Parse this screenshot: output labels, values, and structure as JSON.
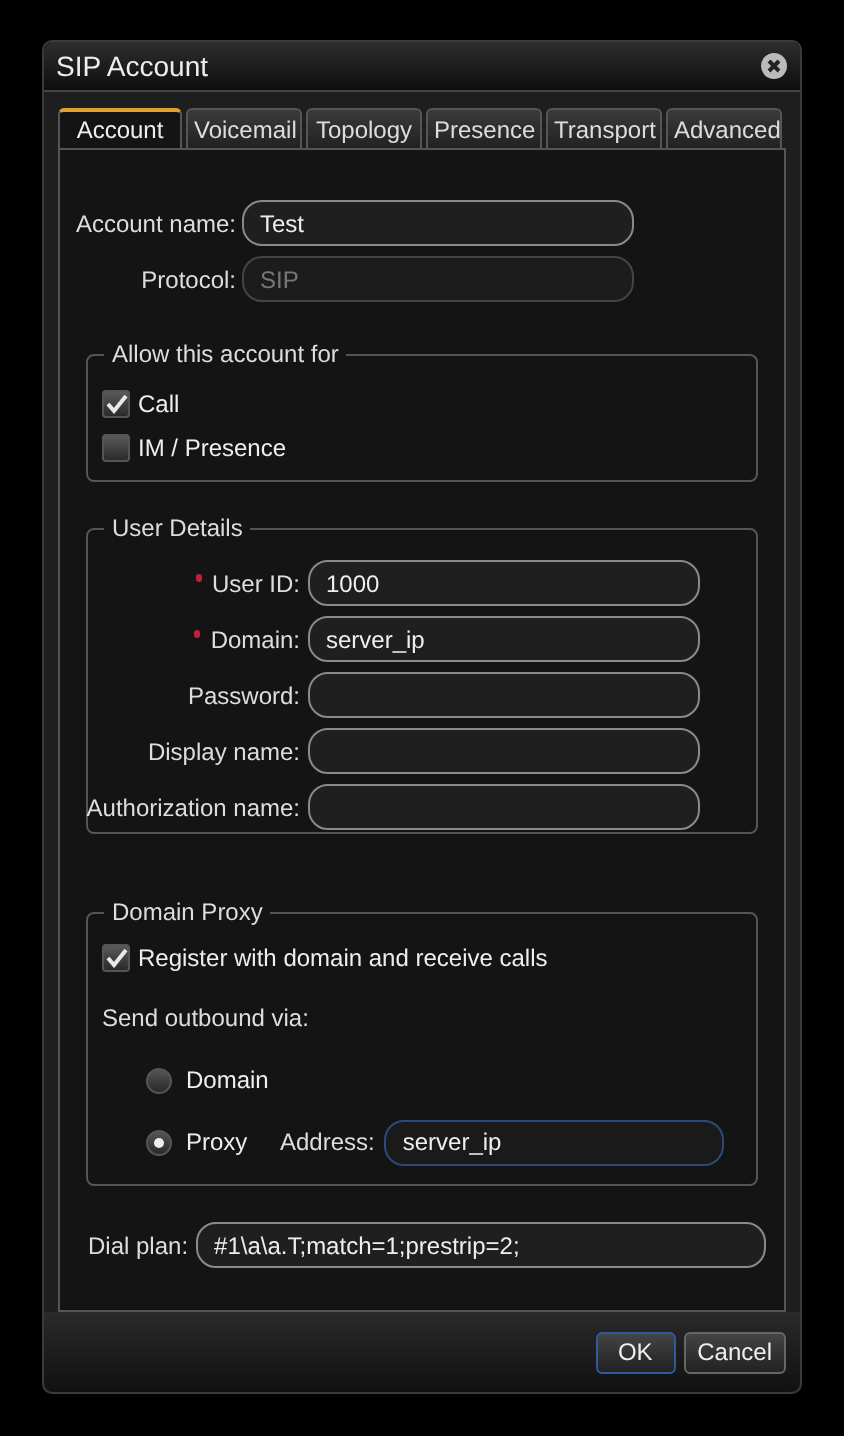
{
  "window": {
    "title": "SIP Account"
  },
  "tabs": [
    {
      "label": "Account",
      "selected": true
    },
    {
      "label": "Voicemail",
      "selected": false
    },
    {
      "label": "Topology",
      "selected": false
    },
    {
      "label": "Presence",
      "selected": false
    },
    {
      "label": "Transport",
      "selected": false
    },
    {
      "label": "Advanced",
      "selected": false
    }
  ],
  "account_fields": [
    {
      "label": "Account name:",
      "value": "Test",
      "disabled": false
    },
    {
      "label": "Protocol:",
      "value": "SIP",
      "disabled": true
    }
  ],
  "allow_group": {
    "title": "Allow this account for",
    "options": [
      {
        "label": "Call",
        "checked": true
      },
      {
        "label": "IM / Presence",
        "checked": false
      }
    ]
  },
  "user_details": {
    "title": "User Details",
    "fields": [
      {
        "label": "User ID:",
        "value": "1000",
        "required": true
      },
      {
        "label": "Domain:",
        "value": "server_ip",
        "required": true
      },
      {
        "label": "Password:",
        "required": false
      },
      {
        "label": "Display name:",
        "required": false
      },
      {
        "label": "Authorization name:",
        "required": false
      }
    ]
  },
  "domain_proxy": {
    "title": "Domain Proxy",
    "register": {
      "label": "Register with domain and receive calls",
      "checked": true
    },
    "send_label": "Send outbound via:",
    "options": [
      {
        "label": "Domain",
        "selected": false
      },
      {
        "label": "Proxy",
        "selected": true
      }
    ],
    "address": {
      "label": "Address:",
      "value": "server_ip",
      "focused": true
    }
  },
  "dial_plan": {
    "label": "Dial plan:",
    "value": "#1\\a\\a.T;match=1;prestrip=2;"
  },
  "buttons": [
    {
      "label": "OK",
      "default": true
    },
    {
      "label": "Cancel",
      "default": false
    }
  ]
}
